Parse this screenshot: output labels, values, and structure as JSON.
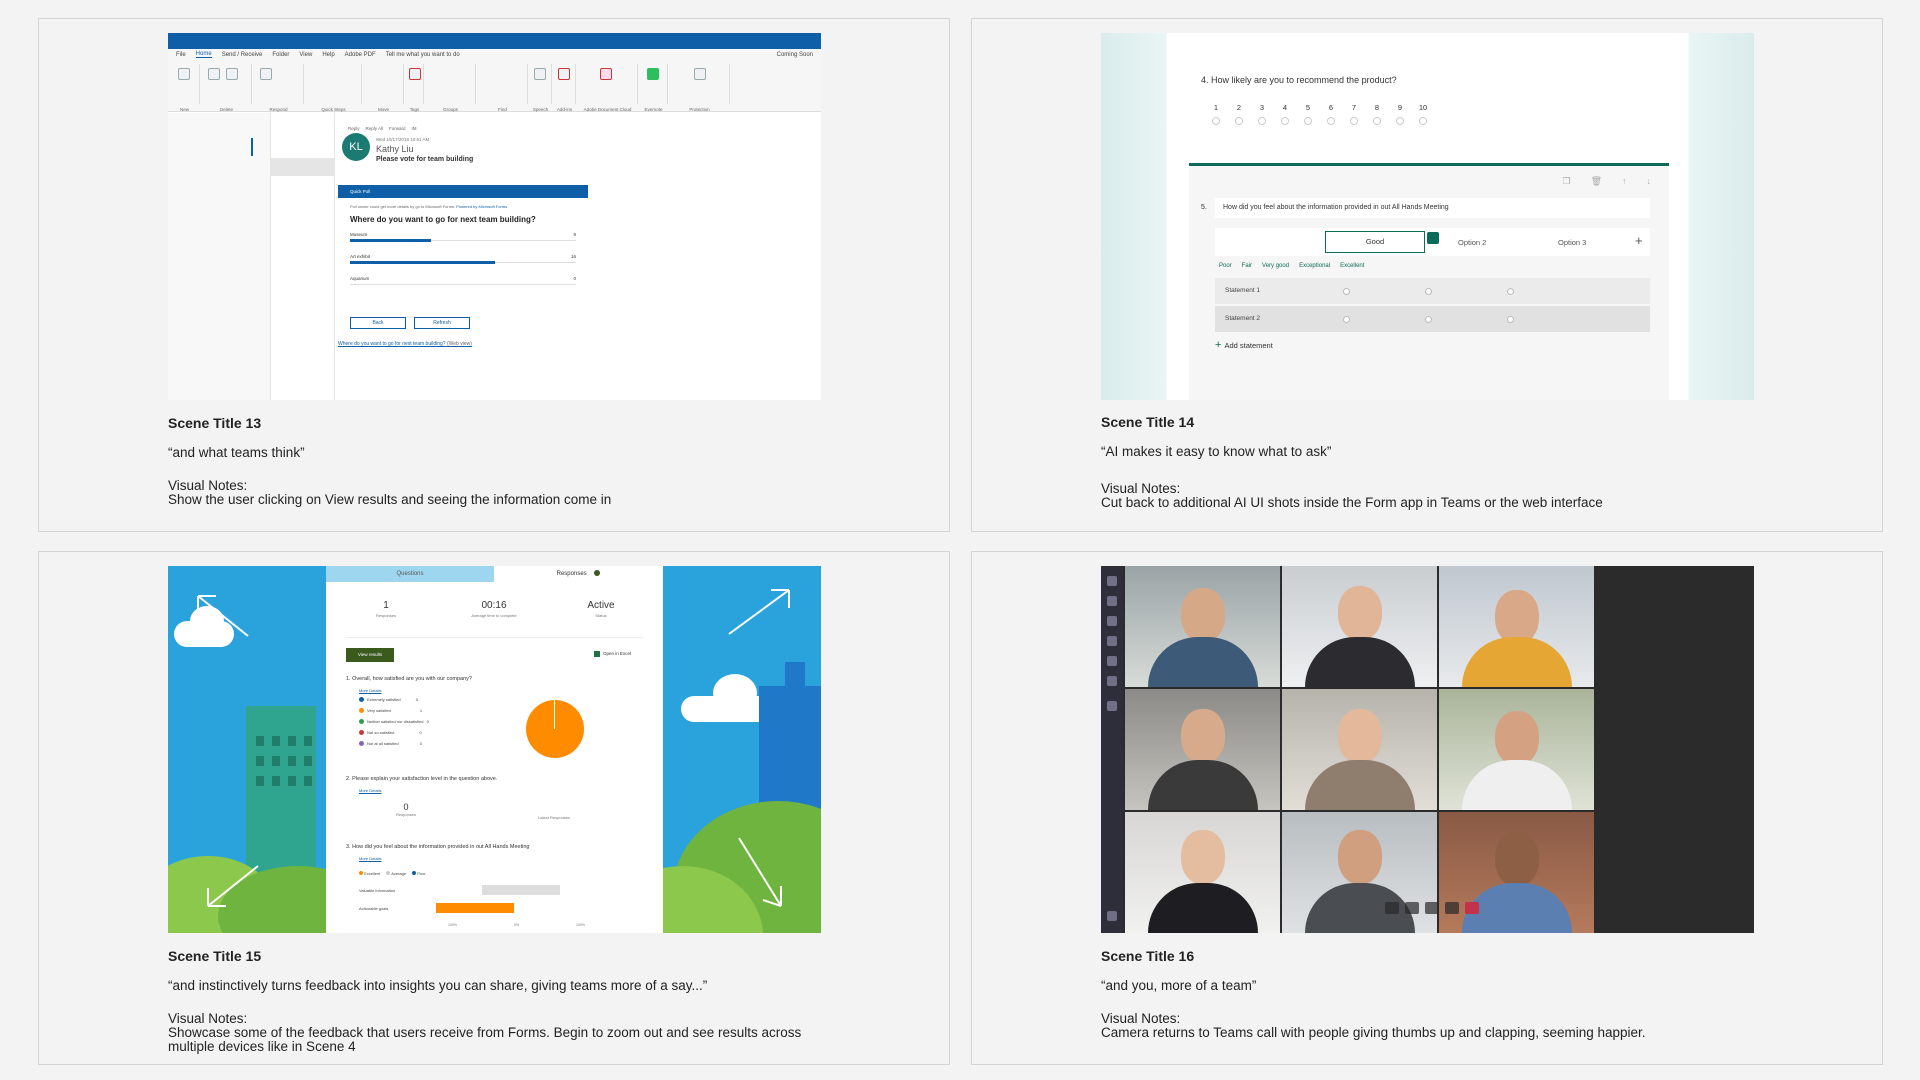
{
  "scenes": [
    {
      "title": "Scene Title 13",
      "quote": "“and what teams think”",
      "visual_notes_label": "Visual Notes:",
      "visual_notes": "Show the user clicking on View results and seeing the information come in",
      "outlook": {
        "menu": [
          "File",
          "Home",
          "Send / Receive",
          "Folder",
          "View",
          "Help",
          "Adobe PDF",
          "Tell me what you want to do"
        ],
        "coming_soon": "Coming Soon",
        "ribbon_groups": [
          "New",
          "Delete",
          "Respond",
          "Quick Steps",
          "Move",
          "Tags",
          "Groups",
          "Find",
          "Speech",
          "Add-ins",
          "Adobe Document Cloud",
          "Evernote",
          "Protection"
        ],
        "reply_actions": [
          "Reply",
          "Reply All",
          "Forward",
          "IM"
        ],
        "date": "Wed 10/17/2018 10:51 AM",
        "avatar_initials": "KL",
        "sender": "Kathy Liu",
        "subject": "Please vote for team building",
        "poll": {
          "header": "Quick Poll",
          "note": "Poll owner could get more details by go to Microsoft Forms.",
          "powered_by": "Powered by Microsoft Forms",
          "question": "Where do you want to go for next team building?",
          "options": [
            {
              "label": "Museum",
              "count": "9",
              "fraction": 0.36
            },
            {
              "label": "Art exhibit",
              "count": "16",
              "fraction": 0.64
            },
            {
              "label": "Aquarium",
              "count": "0",
              "fraction": 0
            }
          ],
          "back": "Back",
          "refresh": "Refresh",
          "link": "Where do you want to go for next team building?",
          "link_suffix": "(Web view)"
        }
      }
    },
    {
      "title": "Scene Title 14",
      "quote": "“AI makes it easy to know what to ask”",
      "visual_notes_label": "Visual Notes:",
      "visual_notes": "Cut back to additional AI UI shots inside the Form app in Teams or the web interface",
      "form": {
        "q4": "4. How likely are you to recommend the product?",
        "scale": [
          "1",
          "2",
          "3",
          "4",
          "5",
          "6",
          "7",
          "8",
          "9",
          "10"
        ],
        "q5_num": "5.",
        "q5": "How did you feel about the information provided in out All Hands Meeting",
        "option1": "Good",
        "option2": "Option 2",
        "option3": "Option 3",
        "suggestions": [
          "Poor",
          "Fair",
          "Very good",
          "Exceptional",
          "Excellent"
        ],
        "statements": [
          "Statement 1",
          "Statement 2"
        ],
        "add_statement": "Add statement"
      }
    },
    {
      "title": "Scene Title 15",
      "quote": "“and instinctively turns feedback into insights you can share, giving teams more of a say...”",
      "visual_notes_label": "Visual Notes:",
      "visual_notes": "Showcase some of the feedback that users receive from Forms. Begin to zoom out and see results across multiple devices like in Scene 4",
      "results": {
        "tabs": [
          "Questions",
          "Responses"
        ],
        "stats": [
          {
            "value": "1",
            "label": "Responses"
          },
          {
            "value": "00:16",
            "label": "Average time to complete"
          },
          {
            "value": "Active",
            "label": "Status"
          }
        ],
        "view_results": "View results",
        "open_excel": "Open in Excel",
        "q1": "1. Overall, how satisfied are you with our company?",
        "more_details": "More Details",
        "q1_legend": [
          {
            "label": "Extremely satisfied",
            "count": "0",
            "color": "#0f5fa8"
          },
          {
            "label": "Very satisfied",
            "count": "1",
            "color": "#ff8c00"
          },
          {
            "label": "Neither satisfied nor dissatisfied",
            "count": "0",
            "color": "#2e9e4a"
          },
          {
            "label": "Not so satisfied",
            "count": "0",
            "color": "#d13438"
          },
          {
            "label": "Not at all satisfied",
            "count": "0",
            "color": "#8764b8"
          }
        ],
        "q2": "2. Please explain your satisfaction level in the question above.",
        "q2_count": "0",
        "q2_count_label": "Responses",
        "latest": "Latest Responses",
        "q3": "3. How did you feel about the information provided in out All Hands Meeting",
        "q3_legend": [
          "Excellent",
          "Average",
          "Poor"
        ],
        "q3_rows": [
          "Valuable information",
          "Actionable goals"
        ],
        "axis": [
          "100%",
          "0%",
          "100%"
        ]
      }
    },
    {
      "title": "Scene Title 16",
      "quote": "“and you, more of a team”",
      "visual_notes_label": "Visual Notes:",
      "visual_notes": "Camera returns to Teams call with people giving thumbs up and clapping, seeming happier."
    }
  ]
}
